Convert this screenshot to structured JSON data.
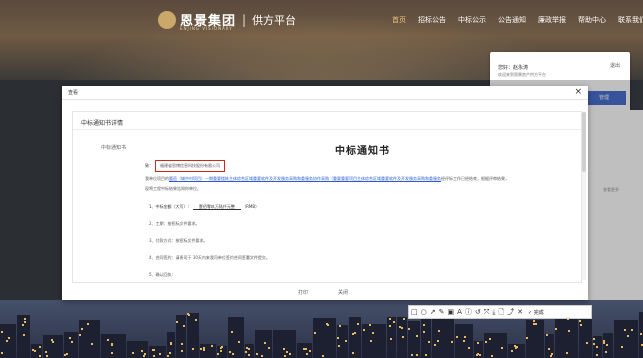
{
  "header": {
    "brand": "恩景集团",
    "brand_en": "ENJING VISIONARY",
    "separator": "|",
    "subtitle": "供方平台",
    "nav": [
      "首页",
      "招标公告",
      "中标公示",
      "公告通知",
      "廉政举报",
      "帮助中心",
      "联系我们"
    ],
    "active_nav": "首页"
  },
  "userbox": {
    "greeting": "您好：赵永涛",
    "welcome": "欢迎来到恩景房产供方平台",
    "logout": "退出",
    "manage_button": "管理"
  },
  "page": {
    "more_link": "查看更多"
  },
  "modal": {
    "title": "查看",
    "close": "×",
    "section_title": "中标通知书详情",
    "field_label": "中标通知书",
    "doc_title": "中标通知书",
    "to_prefix": "致：",
    "to_name": "福建省思博信息科技股份有限公司",
    "intro_prefix": "我单位项目的",
    "project_link": "鹿邑（城中村项目）一期重要楼栋主体综合区域重要软件及开发服务采购和委服务协作采购（重要重要项目主体综合区域重要软件及开发服务采购和委服务",
    "intro_suffix": "经评标工作已经结束，根据评审结果，",
    "line2": "现将工程中标结果告知你单位。",
    "item1_label": "1、中标金额（大写）：",
    "item1_value": "壹佰零玖万陆仟元整",
    "item1_unit": "（RMB）",
    "item2": "2、工期：按招标文件要求。",
    "item3": "3、付款方式：按招标文件要求。",
    "item4": "4、合同签约：请贵司于 30天内来我司单位签约合同签署文件提交。",
    "item5": "5、确认回执：",
    "print_button": "打印",
    "close_button": "关闭"
  },
  "toolbar": {
    "tools": [
      "□",
      "○",
      "↗",
      "✎",
      "▣",
      "A",
      "ⓘ",
      "↺",
      "⤧",
      "⤓",
      "🗋",
      "⤴",
      "✕"
    ],
    "done": "✓ 完成"
  }
}
